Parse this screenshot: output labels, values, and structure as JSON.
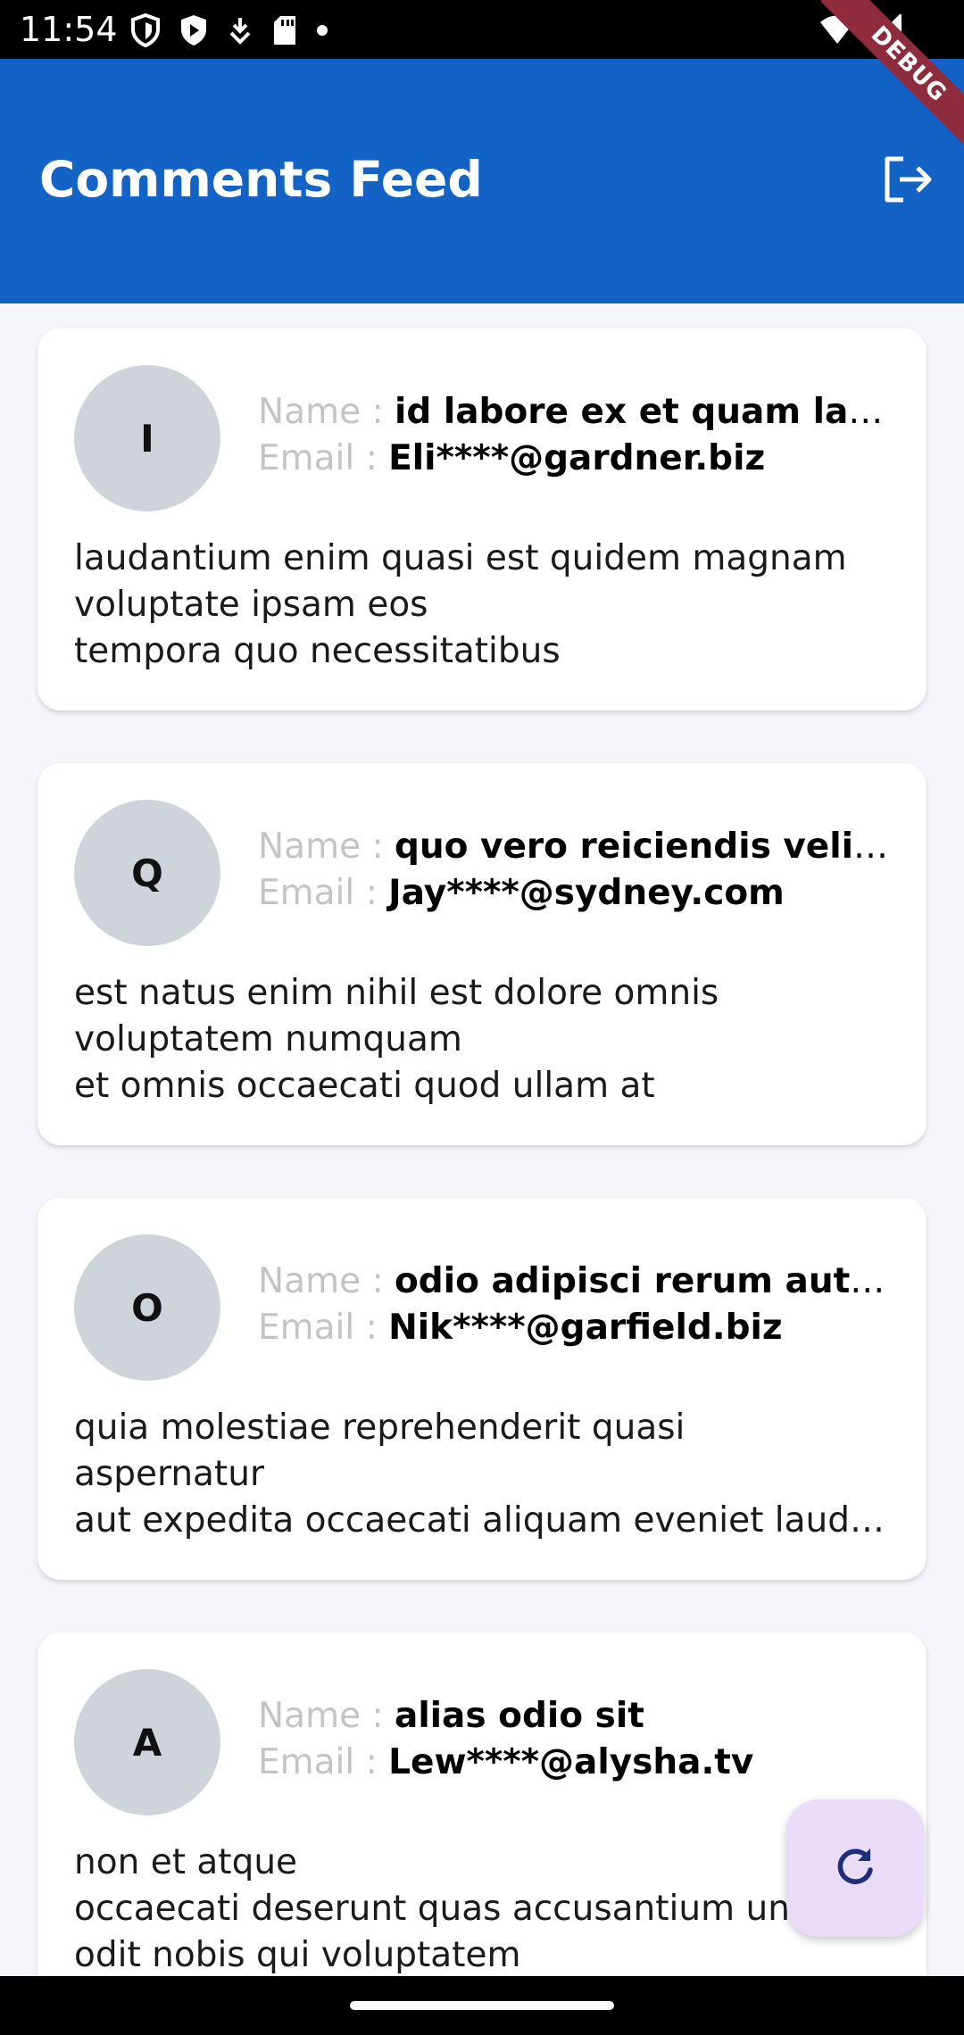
{
  "status_bar": {
    "time": "11:54",
    "left_icons": [
      "shield-icon",
      "play-store-icon",
      "download-icon",
      "sd-card-icon",
      "dot-icon"
    ],
    "right_icons": [
      "wifi-icon",
      "signal-icon"
    ]
  },
  "debug_banner": "DEBUG",
  "app_bar": {
    "title": "Comments Feed",
    "action_icon": "logout-icon"
  },
  "labels": {
    "name": "Name : ",
    "email": "Email : "
  },
  "comments": [
    {
      "initial": "I",
      "name": "id labore ex et quam laborum",
      "email": "Eli****@gardner.biz",
      "body": [
        "laudantium enim quasi est quidem magnam",
        "voluptate ipsam eos",
        "tempora quo necessitatibus"
      ]
    },
    {
      "initial": "Q",
      "name": "quo vero reiciendis velit similique earum",
      "email": "Jay****@sydney.com",
      "body": [
        "est natus enim nihil est dolore omnis",
        "voluptatem numquam",
        "et omnis occaecati quod ullam at"
      ]
    },
    {
      "initial": "O",
      "name": "odio adipisci rerum aut animi",
      "email": "Nik****@garfield.biz",
      "body": [
        "quia molestiae reprehenderit quasi",
        "aspernatur",
        "aut expedita occaecati aliquam eveniet laudantium"
      ]
    },
    {
      "initial": "A",
      "name": "alias odio sit",
      "email": "Lew****@alysha.tv",
      "body": [
        "non et atque",
        "occaecati deserunt quas accusantium unde",
        "odit nobis qui voluptatem"
      ]
    }
  ],
  "fab": {
    "icon": "refresh-icon"
  },
  "colors": {
    "app_bar": "#1363c6",
    "background": "#f4f6fb",
    "avatar": "#cfd3da",
    "fab": "#e8dcf8",
    "fab_icon": "#1f2d7a"
  }
}
